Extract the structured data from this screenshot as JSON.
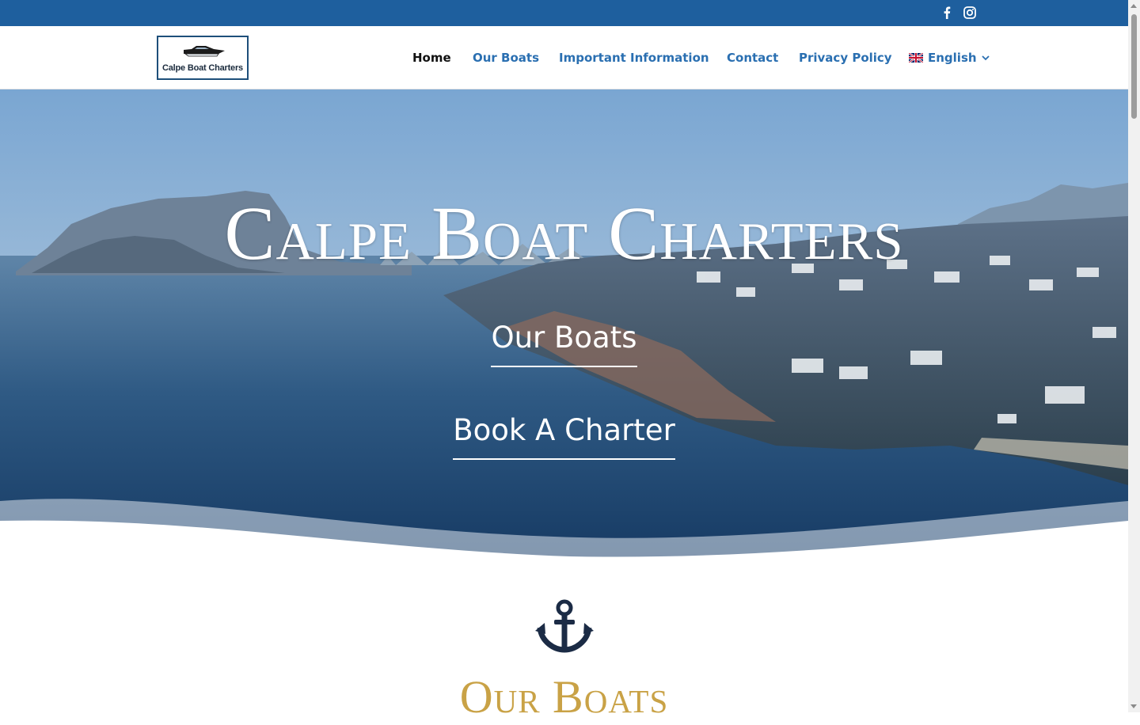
{
  "top_bar": {
    "icons": [
      "facebook-icon",
      "instagram-icon"
    ],
    "color": "#1e5f9e"
  },
  "header": {
    "logo_text": "Calpe Boat Charters",
    "nav": {
      "home": "Home",
      "our_boats": "Our Boats",
      "important_information": "Important Information",
      "contact": "Contact",
      "privacy_policy": "Privacy Policy",
      "language": "English"
    },
    "nav_color": "#2a6fb1",
    "active_color": "#111111"
  },
  "hero": {
    "title": "Calpe Boat Charters",
    "links": {
      "our_boats": "Our Boats",
      "book_a_charter": "Book A Charter"
    }
  },
  "section": {
    "icon": "anchor-icon",
    "title": "Our Boats",
    "title_color": "#c9a246",
    "icon_color": "#1b2b45"
  }
}
